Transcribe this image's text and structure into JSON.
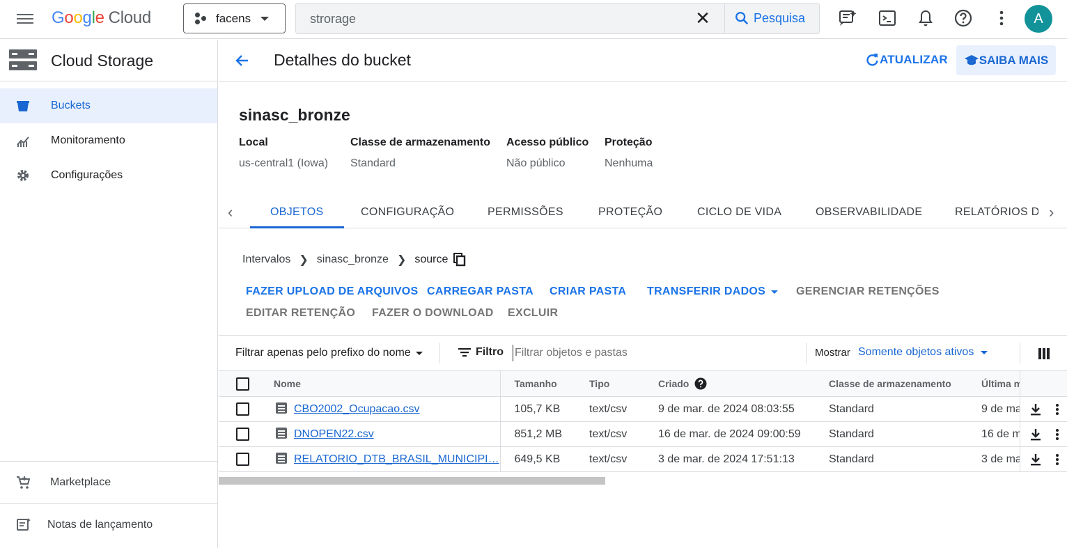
{
  "topbar": {
    "logo": {
      "brand": "Google",
      "product": "Cloud"
    },
    "project": "facens",
    "search": {
      "value": "strorage",
      "button": "Pesquisa"
    },
    "avatar": "A",
    "icons": [
      "menu-icon",
      "release-notes-icon",
      "terminal-icon",
      "bell-icon",
      "help-icon",
      "more-vert-icon"
    ]
  },
  "sidebar": {
    "title": "Cloud Storage",
    "items": [
      {
        "label": "Buckets",
        "icon": "bucket-icon",
        "active": true
      },
      {
        "label": "Monitoramento",
        "icon": "chart-icon"
      },
      {
        "label": "Configurações",
        "icon": "gear-icon"
      }
    ],
    "bottom": [
      {
        "label": "Marketplace",
        "icon": "cart-icon"
      },
      {
        "label": "Notas de lançamento",
        "icon": "notes-icon"
      }
    ]
  },
  "header": {
    "title": "Detalhes do bucket",
    "refresh": "ATUALIZAR",
    "learn": "SAIBA MAIS"
  },
  "bucket": {
    "name": "sinasc_bronze",
    "meta": [
      {
        "k": "Local",
        "v": "us-central1 (Iowa)"
      },
      {
        "k": "Classe de armazenamento",
        "v": "Standard"
      },
      {
        "k": "Acesso público",
        "v": "Não público"
      },
      {
        "k": "Proteção",
        "v": "Nenhuma"
      }
    ]
  },
  "tabs": [
    "OBJETOS",
    "CONFIGURAÇÃO",
    "PERMISSÕES",
    "PROTEÇÃO",
    "CICLO DE VIDA",
    "OBSERVABILIDADE",
    "RELATÓRIOS DE"
  ],
  "breadcrumb": [
    "Intervalos",
    "sinasc_bronze",
    "source"
  ],
  "actions": {
    "upload": "FAZER UPLOAD DE ARQUIVOS",
    "upload_folder": "CARREGAR PASTA",
    "create_folder": "CRIAR PASTA",
    "transfer": "TRANSFERIR DADOS",
    "manage_retention": "GERENCIAR RETENÇÕES",
    "edit_retention": "EDITAR RETENÇÃO",
    "download": "FAZER O DOWNLOAD",
    "delete": "EXCLUIR"
  },
  "filter": {
    "prefix": "Filtrar apenas pelo prefixo do nome",
    "label": "Filtro",
    "placeholder": "Filtrar objetos e pastas",
    "show_label": "Mostrar",
    "show_value": "Somente objetos ativos"
  },
  "table": {
    "columns": [
      "Nome",
      "Tamanho",
      "Tipo",
      "Criado",
      "Classe de armazenamento",
      "Última m"
    ],
    "rows": [
      {
        "name": "CBO2002_Ocupacao.csv",
        "size": "105,7 KB",
        "type": "text/csv",
        "created": "9 de mar. de 2024 08:03:55",
        "class": "Standard",
        "modified": "9 de ma"
      },
      {
        "name": "DNOPEN22.csv",
        "size": "851,2 MB",
        "type": "text/csv",
        "created": "16 de mar. de 2024 09:00:59",
        "class": "Standard",
        "modified": "16 de m"
      },
      {
        "name": "RELATORIO_DTB_BRASIL_MUNICIPI…",
        "size": "649,5 KB",
        "type": "text/csv",
        "created": "3 de mar. de 2024 17:51:13",
        "class": "Standard",
        "modified": "3 de ma"
      }
    ]
  },
  "colors": {
    "accent": "#1a73e8",
    "active_bg": "#e8f0fe",
    "avatar": "#12939a"
  }
}
